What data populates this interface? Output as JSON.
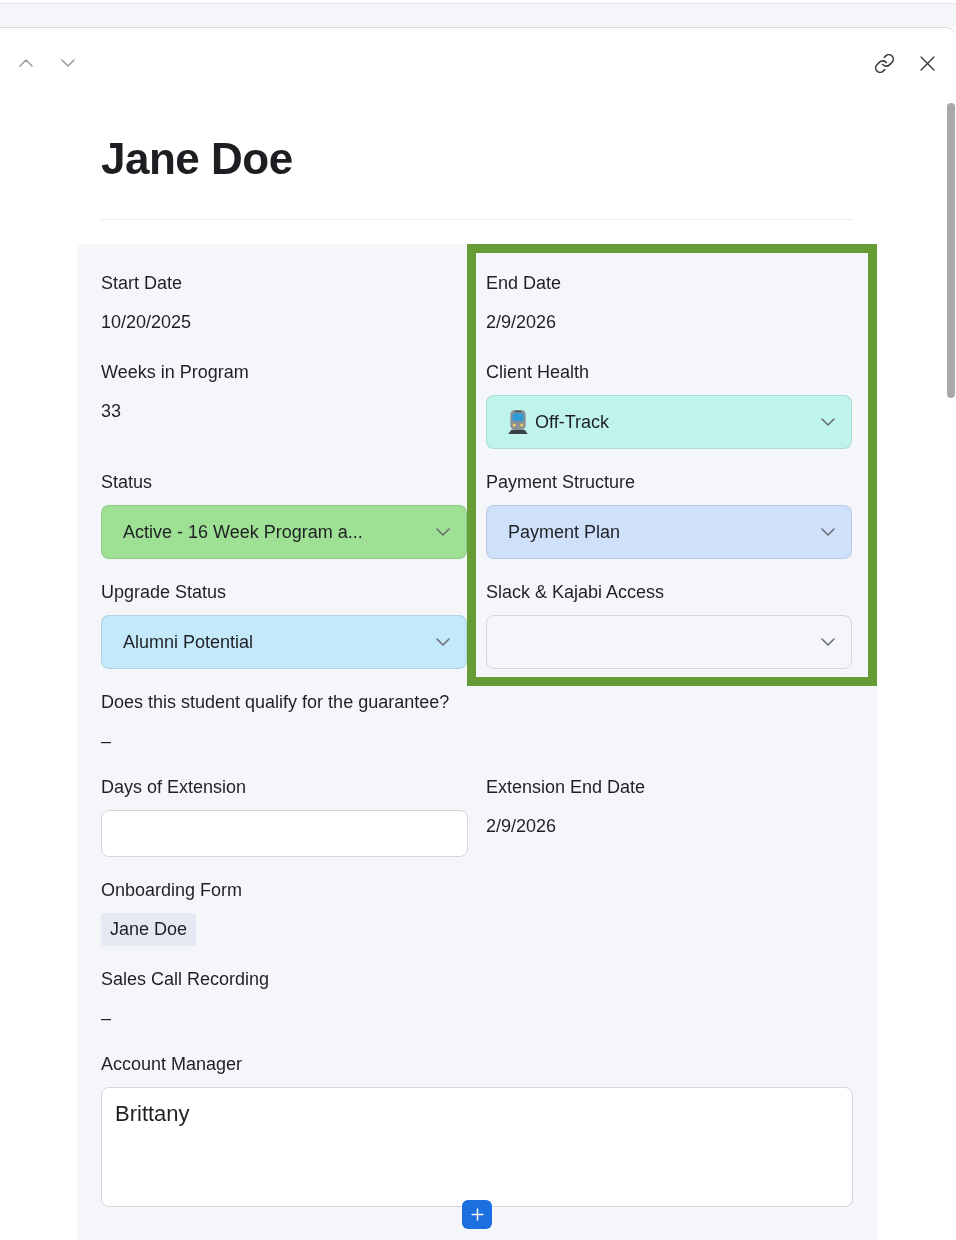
{
  "title": "Jane Doe",
  "columns": [
    {
      "fields": [
        {
          "kind": "text",
          "label": "Start Date",
          "value": "10/20/2025"
        },
        {
          "kind": "text",
          "label": "Weeks in Program",
          "value": "33"
        },
        {
          "kind": "select",
          "label": "Status",
          "value": "Active - 16 Week Program a...",
          "color": "#9ee094"
        },
        {
          "kind": "select",
          "label": "Upgrade Status",
          "value": "Alumni Potential",
          "color": "#c3e9fb"
        }
      ]
    },
    {
      "highlighted": true,
      "fields": [
        {
          "kind": "text",
          "label": "End Date",
          "value": "2/9/2026"
        },
        {
          "kind": "select",
          "label": "Client Health",
          "value": "Off-Track",
          "icon": true,
          "color": "#bff4ed"
        },
        {
          "kind": "select",
          "label": "Payment Structure",
          "value": "Payment Plan",
          "color": "#cfe0fb"
        },
        {
          "kind": "select",
          "label": "Slack & Kajabi Access"
        }
      ]
    }
  ],
  "rows": [
    {
      "fields": [
        {
          "kind": "text",
          "label": "Does this student qualify for the guarantee?",
          "value": "–"
        }
      ]
    },
    {
      "fields": [
        {
          "kind": "input",
          "label": "Days of Extension"
        },
        {
          "kind": "text",
          "label": "Extension End Date",
          "value": "2/9/2026"
        }
      ]
    },
    {
      "fields": [
        {
          "kind": "chip",
          "label": "Onboarding Form",
          "value": "Jane Doe"
        }
      ]
    },
    {
      "fields": [
        {
          "kind": "text",
          "label": "Sales Call Recording",
          "value": "–"
        }
      ]
    },
    {
      "fields": [
        {
          "kind": "textarea",
          "label": "Account Manager",
          "value": "Brittany"
        }
      ]
    }
  ]
}
